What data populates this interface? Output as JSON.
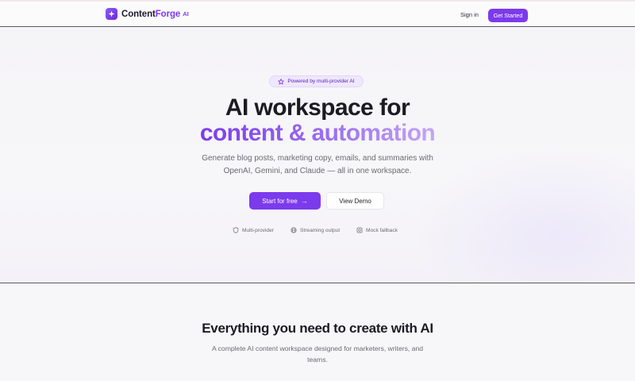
{
  "nav": {
    "brand_main": "Content",
    "brand_accent": "Forge",
    "brand_suffix": "AI",
    "signin_label": "Sign in",
    "getstarted_label": "Get Started"
  },
  "hero": {
    "badge": "Powered by multi-provider AI",
    "headline_line1": "AI workspace for",
    "headline_line2": "content & automation",
    "subtitle": "Generate blog posts, marketing copy, emails, and summaries with OpenAI, Gemini, and Claude — all in one workspace.",
    "primary_cta": "Start for free",
    "secondary_cta": "View Demo",
    "features": [
      "Multi-provider",
      "Streaming output",
      "Mock fallback"
    ]
  },
  "features_section": {
    "title": "Everything you need to create with AI",
    "subtitle": "A complete AI content workspace designed for marketers, writers, and teams."
  },
  "colors": {
    "accent": "#7c3aed",
    "accent_light": "#c4a6f6",
    "text": "#1c1b22",
    "muted": "#6b6a75"
  },
  "icons": {
    "logo": "sparkle-icon",
    "badge": "star-icon",
    "cta_arrow": "arrow-right-icon",
    "feature_1": "shield-icon",
    "feature_2": "globe-icon",
    "feature_3": "database-icon"
  }
}
